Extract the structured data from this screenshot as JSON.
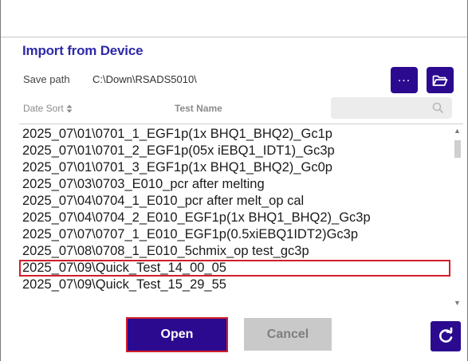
{
  "dialog": {
    "title": "Import from Device",
    "save_path_label": "Save path",
    "save_path_value": "C:\\Down\\RSADS5010\\",
    "more_button_label": "...",
    "folder_icon": "folder-open-icon"
  },
  "list_header": {
    "date_sort_label": "Date Sort",
    "sort_icon": "sort-icon",
    "test_name_label": "Test Name",
    "search_placeholder": "",
    "search_icon": "search-icon"
  },
  "files": [
    "2025_07\\01\\0701_1_EGF1p(1x BHQ1_BHQ2)_Gc1p",
    "2025_07\\01\\0701_2_EGF1p(05x iEBQ1_IDT1)_Gc3p",
    "2025_07\\01\\0701_3_EGF1p(1x BHQ1_BHQ2)_Gc0p",
    "2025_07\\03\\0703_E010_pcr after melting",
    "2025_07\\04\\0704_1_E010_pcr after melt_op cal",
    "2025_07\\04\\0704_2_E010_EGF1p(1x BHQ1_BHQ2)_Gc3p",
    "2025_07\\07\\0707_1_E010_EGF1p(0.5xiEBQ1IDT2)Gc3p",
    "2025_07\\08\\0708_1_E010_5chmix_op test_gc3p",
    "2025_07\\09\\Quick_Test_14_00_05",
    "2025_07\\09\\Quick_Test_15_29_55"
  ],
  "selected_file": "2025_07\\09\\Quick_Test_14_00_05",
  "actions": {
    "open_label": "Open",
    "cancel_label": "Cancel",
    "refresh_icon": "refresh-icon"
  },
  "colors": {
    "accent": "#2b0a8f",
    "title": "#2e2aa8",
    "highlight_border": "#d21e2b",
    "disabled_button": "#c9c9c9"
  }
}
